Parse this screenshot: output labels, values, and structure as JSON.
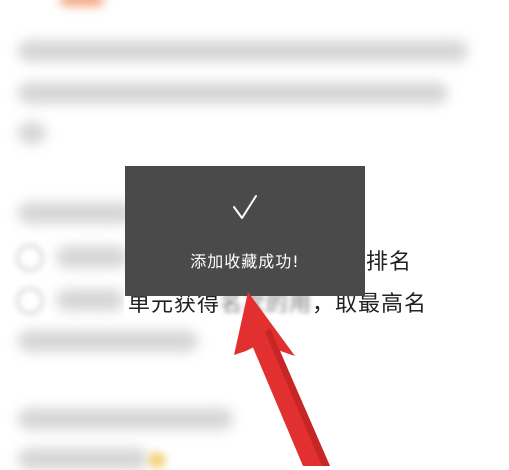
{
  "content": {
    "row1_suffix": "排名",
    "row2_prefix": "单元获得",
    "row2_blurred": "名次的用",
    "row2_suffix": "，取最高名"
  },
  "toast": {
    "icon": "checkmark-icon",
    "message": "添加收藏成功!"
  },
  "colors": {
    "toast_bg": "#4a4a4a",
    "arrow_red": "#e02424"
  }
}
